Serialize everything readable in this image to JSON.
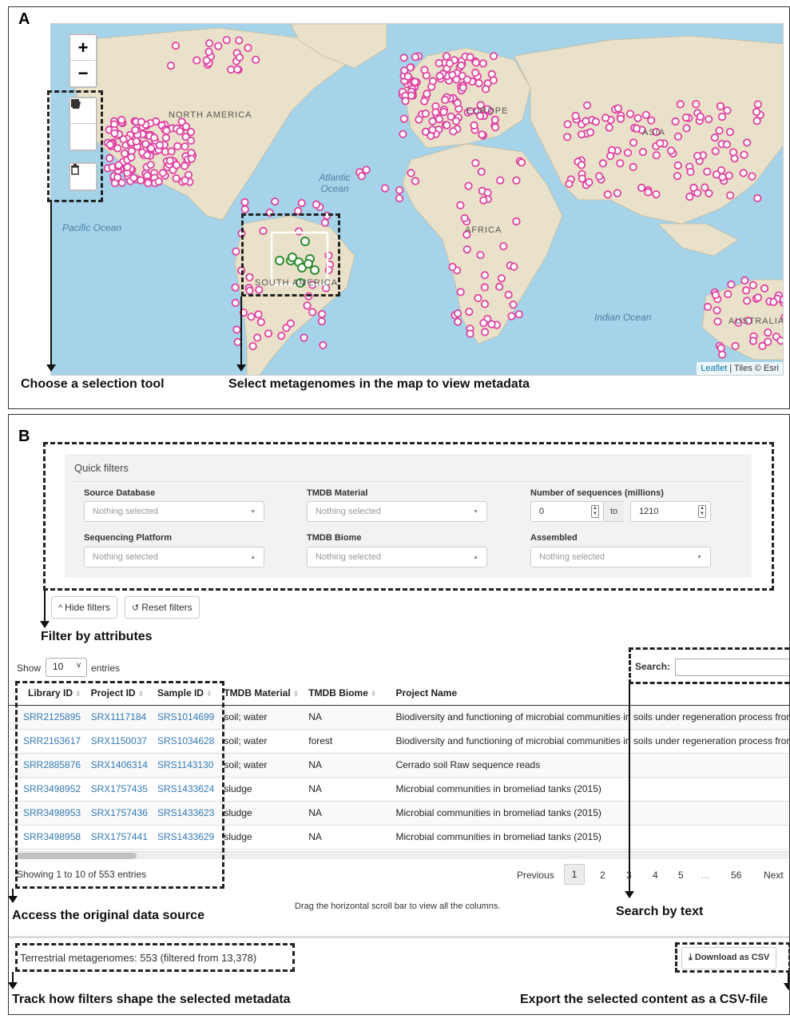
{
  "panel_a": {
    "letter": "A",
    "map": {
      "zoom_in": "+",
      "zoom_out": "−",
      "labels": {
        "north_america": "NORTH AMERICA",
        "europe": "EUROPE",
        "asia": "ASIA",
        "africa": "AFRICA",
        "south_america": "SOUTH AMERICA",
        "australia": "AUSTRALIA",
        "pacific": "Pacific Ocean",
        "atlantic": "Atlantic Ocean",
        "indian": "Indian Ocean"
      },
      "attribution_link": "Leaflet",
      "attribution_text": " | Tiles © Esri",
      "tools": [
        "polygon-icon",
        "rectangle-icon",
        "trash-icon"
      ],
      "colors": {
        "ocean": "#a4d3ea",
        "land": "#e8e0c8",
        "marker": "#e040a0",
        "selected_marker": "#2e8b2e"
      }
    },
    "callouts": {
      "selection_tool": "Choose a selection tool",
      "select_metagenomes": "Select metagenomes in the map to view metadata"
    }
  },
  "panel_b": {
    "letter": "B",
    "quick_filters": {
      "title": "Quick filters",
      "source_database": {
        "label": "Source Database",
        "placeholder": "Nothing selected"
      },
      "tmdb_material": {
        "label": "TMDB Material",
        "placeholder": "Nothing selected"
      },
      "num_sequences": {
        "label": "Number of sequences (millions)",
        "min": "0",
        "to": "to",
        "max": "1210"
      },
      "sequencing_platform": {
        "label": "Sequencing Platform",
        "placeholder": "Nothing selected"
      },
      "tmdb_biome": {
        "label": "TMDB Biome",
        "placeholder": "Nothing selected"
      },
      "assembled": {
        "label": "Assembled",
        "placeholder": "Nothing selected"
      }
    },
    "buttons": {
      "hide_filters": "Hide filters",
      "reset_filters": "Reset filters",
      "download_csv": "Download as CSV"
    },
    "table": {
      "show_label": "Show",
      "entries_label": "entries",
      "length": "10",
      "search_label": "Search:",
      "columns": [
        "Library ID",
        "Project ID",
        "Sample ID",
        "TMDB Material",
        "TMDB Biome",
        "Project Name"
      ],
      "rows": [
        [
          "SRR2125895",
          "SRX1117184",
          "SRS1014699",
          "soil; water",
          "NA",
          "Biodiversity and functioning of microbial communities in soils under regeneration process from a"
        ],
        [
          "SRR2163617",
          "SRX1150037",
          "SRS1034628",
          "soil; water",
          "forest",
          "Biodiversity and functioning of microbial communities in soils under regeneration process from a"
        ],
        [
          "SRR2885876",
          "SRX1406314",
          "SRS1143130",
          "soil; water",
          "NA",
          "Cerrado soil Raw sequence reads"
        ],
        [
          "SRR3498952",
          "SRX1757435",
          "SRS1433624",
          "sludge",
          "NA",
          "Microbial communities in bromeliad tanks (2015)"
        ],
        [
          "SRR3498953",
          "SRX1757436",
          "SRS1433623",
          "sludge",
          "NA",
          "Microbial communities in bromeliad tanks (2015)"
        ],
        [
          "SRR3498958",
          "SRX1757441",
          "SRS1433629",
          "sludge",
          "NA",
          "Microbial communities in bromeliad tanks (2015)"
        ]
      ],
      "info": "Showing 1 to 10 of 553 entries",
      "pagination": {
        "previous": "Previous",
        "pages": [
          "1",
          "2",
          "3",
          "4",
          "5",
          "…",
          "56"
        ],
        "current": "1",
        "next": "Next"
      }
    },
    "scroll_hint": "Drag the horizontal scroll bar to view all the columns.",
    "summary": "Terrestrial metagenomes: 553 (filtered from 13,378)",
    "callouts": {
      "filter": "Filter by attributes",
      "access": "Access the original data source",
      "search": "Search by text",
      "track": "Track how filters shape the selected metadata",
      "export": "Export the selected content as a CSV-file"
    }
  }
}
